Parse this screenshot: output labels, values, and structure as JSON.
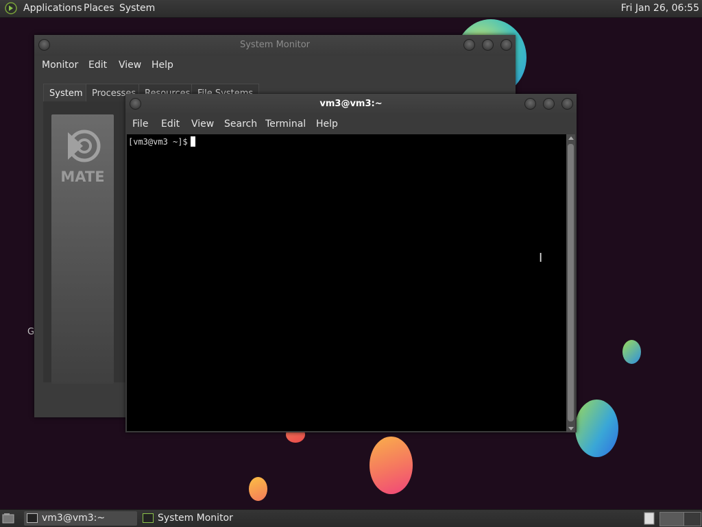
{
  "top_panel": {
    "menus": [
      "Applications",
      "Places",
      "System"
    ],
    "clock": "Fri Jan 26, 06:55"
  },
  "desktop": {
    "partial_letter": "G"
  },
  "system_monitor": {
    "title": "System Monitor",
    "menus": [
      "Monitor",
      "Edit",
      "View",
      "Help"
    ],
    "tabs": [
      "System",
      "Processes",
      "Resources",
      "File Systems"
    ],
    "active_tab": "System",
    "logo_text": "MATE"
  },
  "terminal": {
    "title": "vm3@vm3:~",
    "menus": [
      "File",
      "Edit",
      "View",
      "Search",
      "Terminal",
      "Help"
    ],
    "prompt": "[vm3@vm3 ~]$"
  },
  "taskbar": {
    "tasks": [
      {
        "label": "vm3@vm3:~",
        "icon": "terminal-icon",
        "active": true
      },
      {
        "label": "System Monitor",
        "icon": "system-monitor-icon",
        "active": false
      }
    ]
  }
}
